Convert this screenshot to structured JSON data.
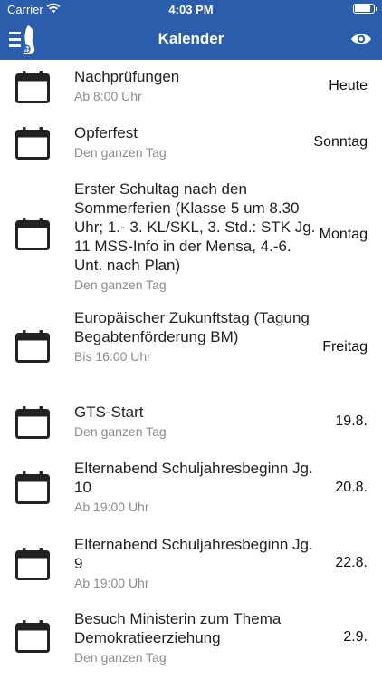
{
  "status_bar": {
    "carrier": "Carrier",
    "time": "4:03 PM"
  },
  "nav": {
    "title": "Kalender"
  },
  "colors": {
    "header": "#2b5dad",
    "subtitle": "#8c8c8c"
  },
  "events": [
    {
      "title": "Nachprüfungen",
      "subtitle": "Ab 8:00 Uhr",
      "date": "Heute"
    },
    {
      "title": "Opferfest",
      "subtitle": "Den ganzen Tag",
      "date": "Sonntag"
    },
    {
      "title": "Erster Schultag nach den Sommerferien (Klasse 5 um 8.30 Uhr; 1.- 3. KL/SKL, 3. Std.: STK Jg. 11 MSS-Info in der Mensa, 4.-6. Unt. nach Plan)",
      "subtitle": "Den ganzen Tag",
      "date": "Montag"
    },
    {
      "title": "Europäischer Zukunftstag (Tagung Begabtenförderung BM)",
      "subtitle": "Bis 16:00 Uhr",
      "date": "Freitag"
    },
    {
      "title": "GTS-Start",
      "subtitle": "Den ganzen Tag",
      "date": "19.8."
    },
    {
      "title": "Elternabend Schuljahresbeginn Jg. 10",
      "subtitle": "Ab 19:00 Uhr",
      "date": "20.8."
    },
    {
      "title": "Elternabend Schuljahresbeginn Jg. 9",
      "subtitle": "Ab 19:00 Uhr",
      "date": "22.8."
    },
    {
      "title": "Besuch Ministerin zum Thema Demokratieerziehung",
      "subtitle": "Den ganzen Tag",
      "date": "2.9."
    }
  ]
}
